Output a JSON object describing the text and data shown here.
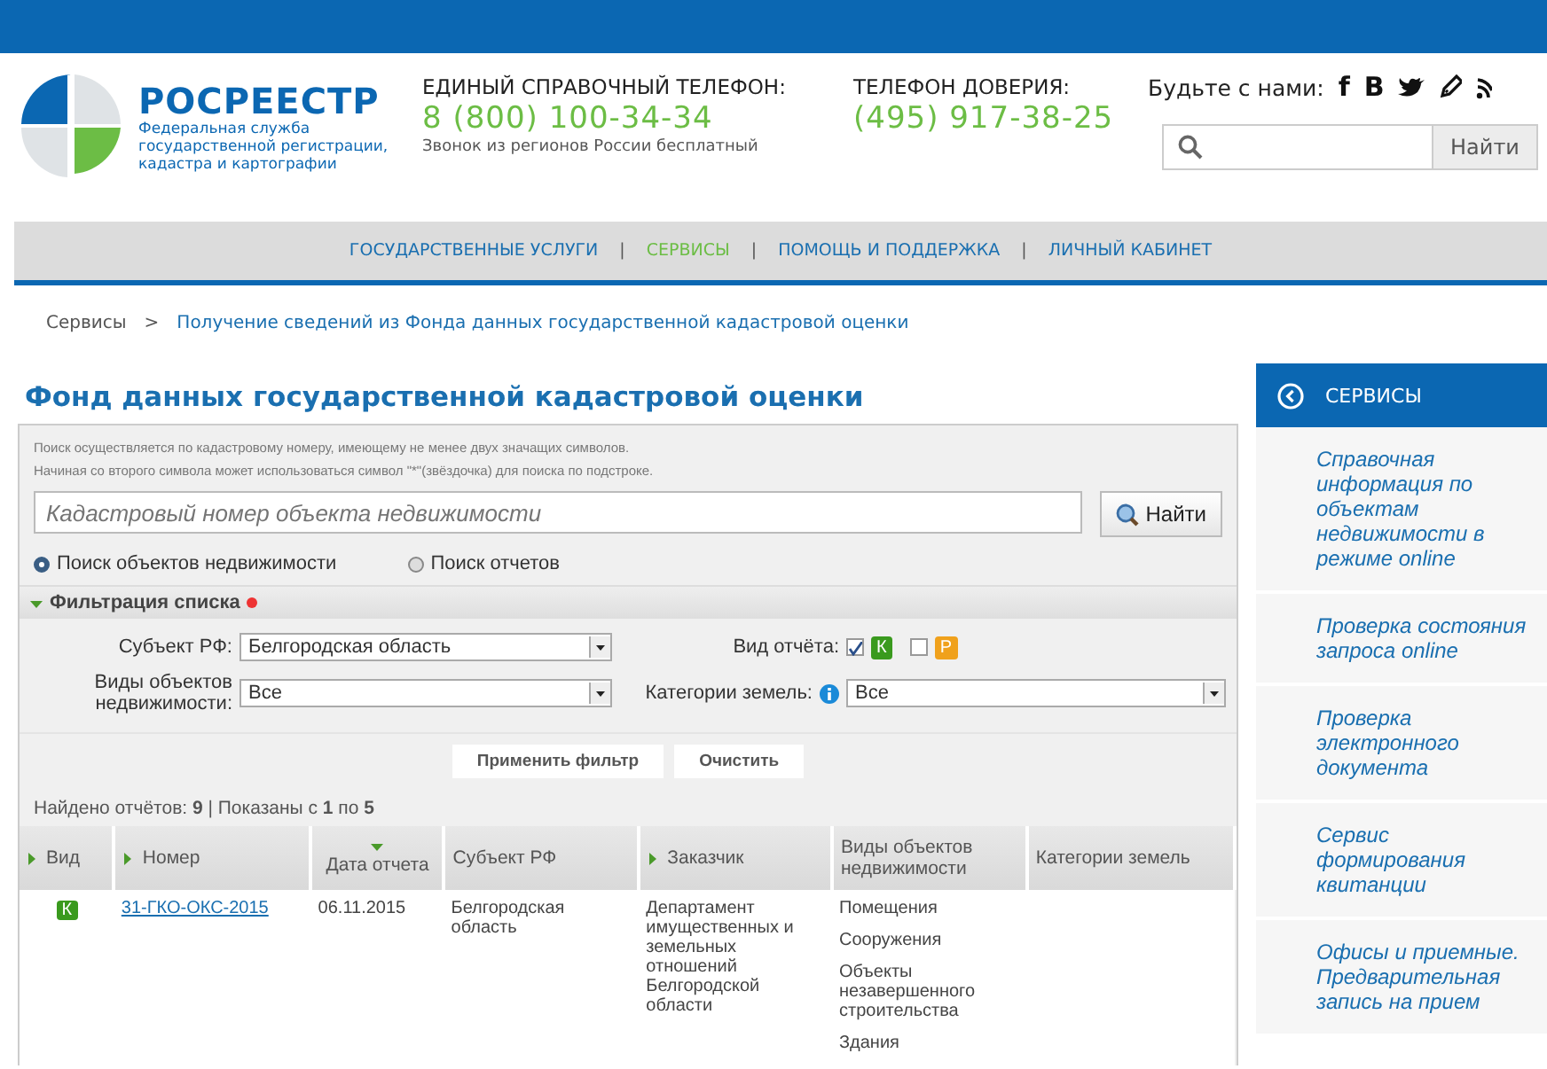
{
  "header": {
    "logo_title": "РОСРЕЕСТР",
    "logo_subtitle": "Федеральная служба государственной регистрации, кадастра и картографии",
    "phones": [
      {
        "label": "ЕДИНЫЙ СПРАВОЧНЫЙ ТЕЛЕФОН:",
        "number": "8 (800) 100-34-34",
        "note": "Звонок из регионов России бесплатный"
      },
      {
        "label": "ТЕЛЕФОН ДОВЕРИЯ:",
        "number": "(495) 917-38-25"
      }
    ],
    "social_label": "Будьте с нами:",
    "social": [
      {
        "kind": "letter",
        "text": "f"
      },
      {
        "kind": "letter",
        "text": "B"
      },
      {
        "kind": "bird"
      },
      {
        "kind": "pencil"
      },
      {
        "kind": "rss"
      }
    ],
    "search_button": "Найти"
  },
  "nav": [
    {
      "label": "ГОСУДАРСТВЕННЫЕ УСЛУГИ",
      "selected": false
    },
    {
      "label": "СЕРВИСЫ",
      "selected": true
    },
    {
      "label": "ПОМОЩЬ И ПОДДЕРЖКА",
      "selected": false
    },
    {
      "label": "ЛИЧНЫЙ КАБИНЕТ",
      "selected": false
    }
  ],
  "nav_separator": "|",
  "breadcrumb": {
    "items": [
      "Сервисы",
      "Получение сведений из Фонда данных государственной кадастровой оценки"
    ],
    "separator": ">"
  },
  "page_title": "Фонд данных государственной кадастровой оценки",
  "search": {
    "hints": [
      "Поиск осуществляется по кадастровому номеру, имеющему не менее двух значащих символов.",
      "Начиная со второго символа может использоваться символ \"*\"(звёздочка) для поиска по подстроке."
    ],
    "placeholder": "Кадастровый номер объекта недвижимости",
    "button": "Найти",
    "modes": [
      {
        "label": "Поиск объектов недвижимости",
        "selected": true
      },
      {
        "label": "Поиск отчетов",
        "selected": false
      }
    ]
  },
  "filter": {
    "title": "Фильтрация списка",
    "expanded": true,
    "subject_label": "Субъект РФ:",
    "subject_value": "Белгородская область",
    "object_types_label": "Виды объектов недвижимости:",
    "object_types_value": "Все",
    "report_type_label": "Вид отчёта:",
    "report_types": [
      {
        "badge": "К",
        "color": "#3a9a1e",
        "checked": true
      },
      {
        "badge": "Р",
        "color": "#f0a11c",
        "checked": false
      }
    ],
    "land_label": "Категории земель:",
    "land_value": "Все",
    "buttons": [
      "Применить фильтр",
      "Очистить"
    ]
  },
  "summary": "Найдено отчётов: **9** | Показаны с **1** по **5**",
  "table": {
    "columns": [
      {
        "label": "Вид",
        "sortable": true,
        "sorted": false
      },
      {
        "label": "Номер",
        "sortable": true,
        "sorted": false
      },
      {
        "label": "Дата отчета",
        "sortable": true,
        "sorted": true
      },
      {
        "label": "Субъект РФ",
        "sortable": false,
        "sorted": false
      },
      {
        "label": "Заказчик",
        "sortable": true,
        "sorted": false
      },
      {
        "label": "Виды объектов недвижимости",
        "sortable": false,
        "sorted": false
      },
      {
        "label": "Категории земель",
        "sortable": false,
        "sorted": false
      }
    ],
    "rows": [
      {
        "badge": "К",
        "color": "#3a9a1e",
        "number": "31-ГКО-ОКС-2015",
        "date": "06.11.2015",
        "subject": "Белгородская область",
        "customer": "Департамент имущественных и земельных отношений Белгородской области",
        "object_types": [
          "Помещения",
          "Сооружения",
          "Объекты незавершенного строительства",
          "Здания"
        ]
      }
    ]
  },
  "sidebar": {
    "title": "СЕРВИСЫ",
    "items": [
      "Справочная информация по объектам недвижимости в режиме online",
      "Проверка состояния запроса online",
      "Проверка электронного документа",
      "Сервис формирования квитанции",
      "Офисы и приемные. Предварительная запись на прием"
    ]
  }
}
